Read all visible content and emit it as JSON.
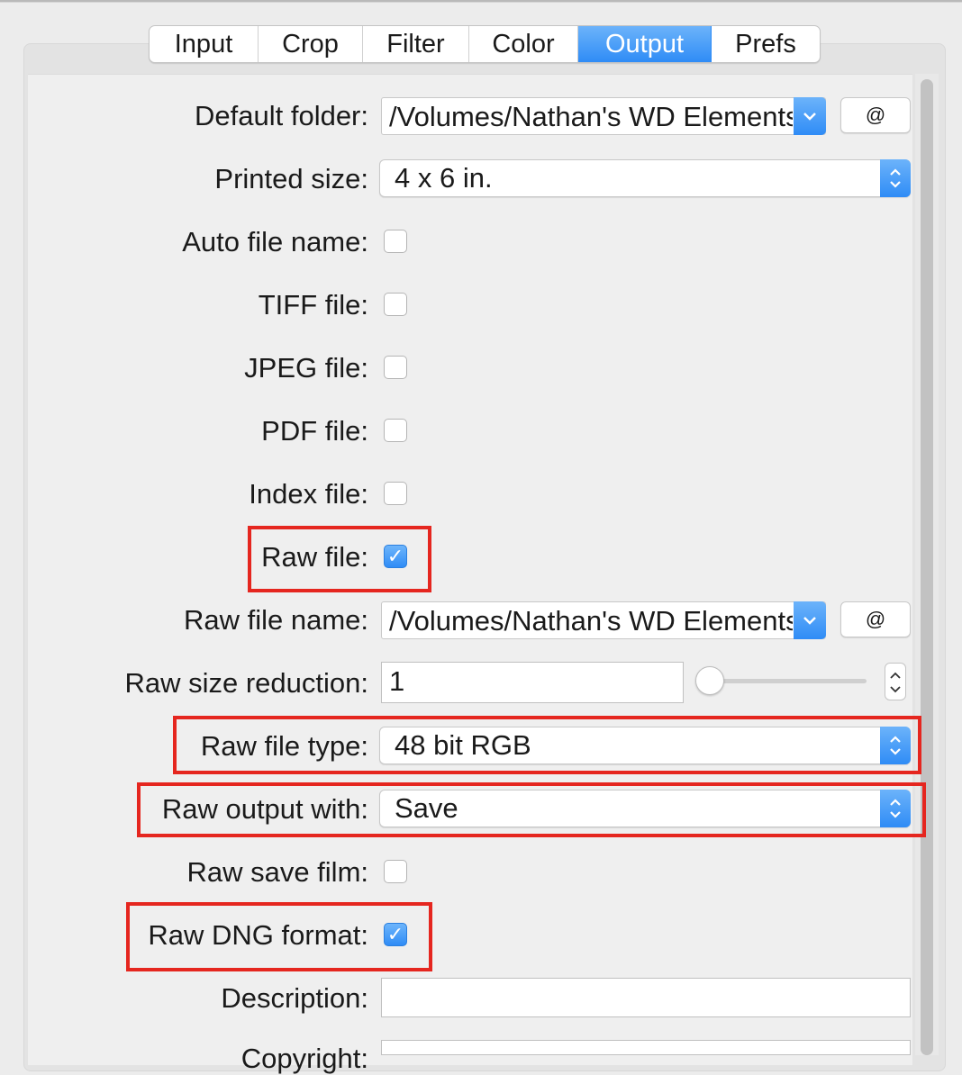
{
  "tabs": [
    {
      "label": "Input",
      "active": false
    },
    {
      "label": "Crop",
      "active": false
    },
    {
      "label": "Filter",
      "active": false
    },
    {
      "label": "Color",
      "active": false
    },
    {
      "label": "Output",
      "active": true
    },
    {
      "label": "Prefs",
      "active": false
    }
  ],
  "fields": {
    "default_folder": {
      "label": "Default folder:",
      "value": "/Volumes/Nathan's WD Elements",
      "button": "@"
    },
    "printed_size": {
      "label": "Printed size:",
      "value": "4 x 6 in."
    },
    "auto_file_name": {
      "label": "Auto file name:",
      "checked": false
    },
    "tiff_file": {
      "label": "TIFF file:",
      "checked": false
    },
    "jpeg_file": {
      "label": "JPEG file:",
      "checked": false
    },
    "pdf_file": {
      "label": "PDF file:",
      "checked": false
    },
    "index_file": {
      "label": "Index file:",
      "checked": false
    },
    "raw_file": {
      "label": "Raw file:",
      "checked": true
    },
    "raw_file_name": {
      "label": "Raw file name:",
      "value": "/Volumes/Nathan's WD Elements",
      "button": "@"
    },
    "raw_size_reduction": {
      "label": "Raw size reduction:",
      "value": "1"
    },
    "raw_file_type": {
      "label": "Raw file type:",
      "value": "48 bit RGB"
    },
    "raw_output_with": {
      "label": "Raw output with:",
      "value": "Save"
    },
    "raw_save_film": {
      "label": "Raw save film:",
      "checked": false
    },
    "raw_dng_format": {
      "label": "Raw DNG format:",
      "checked": true
    },
    "description": {
      "label": "Description:",
      "value": ""
    },
    "copyright": {
      "label": "Copyright:",
      "value": ""
    }
  },
  "colors": {
    "accent": "#2f8cf6",
    "highlight": "#e5261f"
  },
  "icons": {
    "check": "✓"
  }
}
